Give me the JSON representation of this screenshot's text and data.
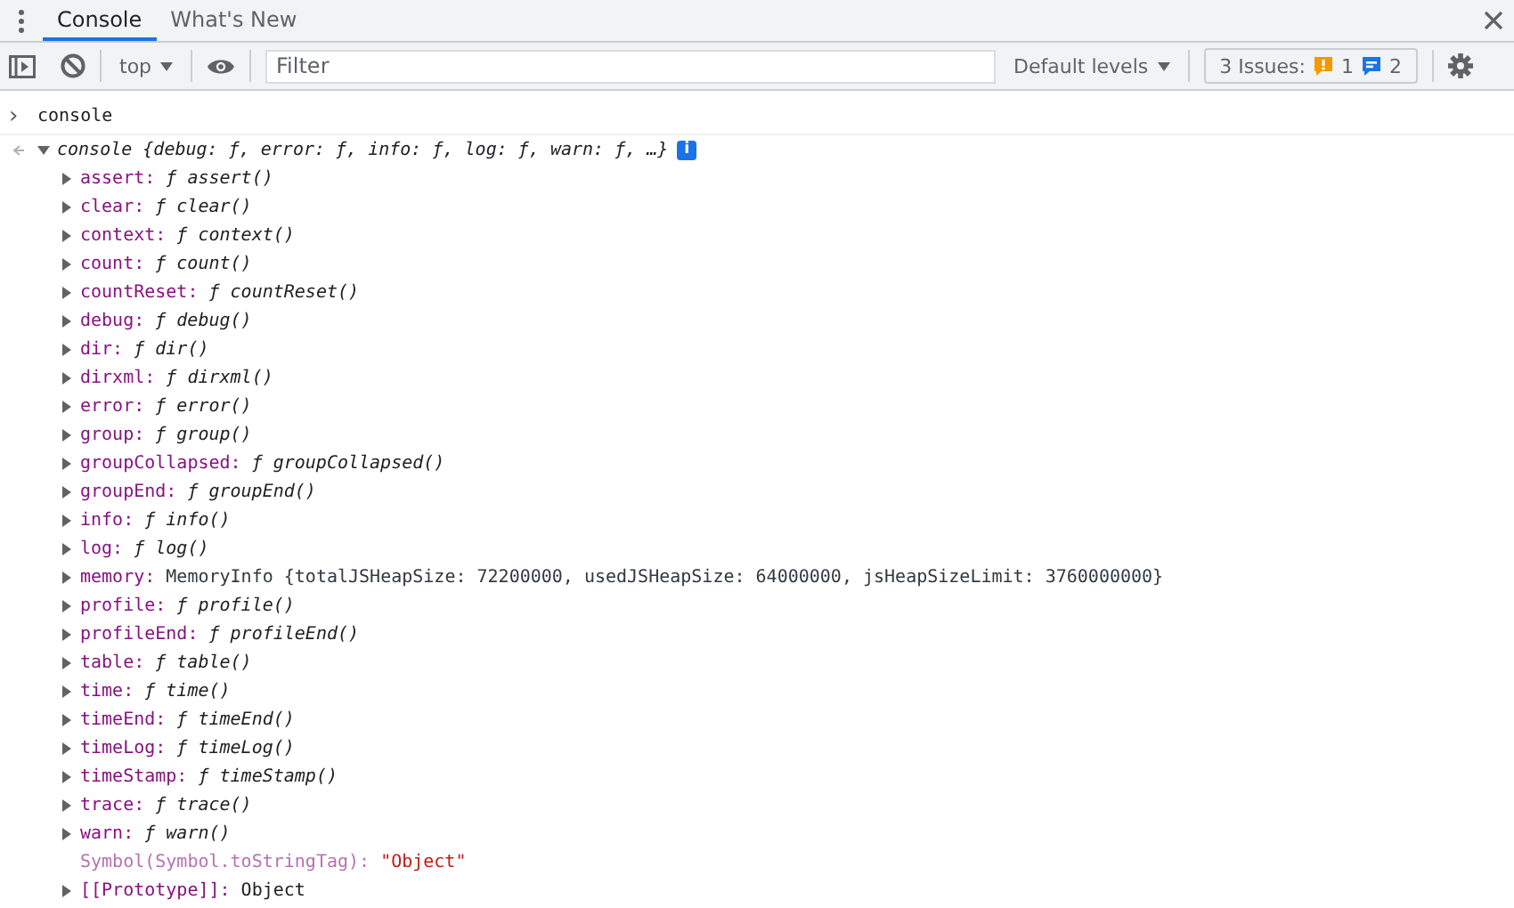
{
  "tabs": [
    {
      "label": "Console",
      "selected": true
    },
    {
      "label": "What's New",
      "selected": false
    }
  ],
  "toolbar": {
    "context": "top",
    "filter": {
      "placeholder": "Filter"
    },
    "levels": "Default levels",
    "issues": {
      "label": "3 Issues:",
      "warnings": "1",
      "infos": "2"
    }
  },
  "input": {
    "prompt": "›",
    "text": "console"
  },
  "output": {
    "expanded": true,
    "summary": "console {debug: ƒ, error: ƒ, info: ƒ, log: ƒ, warn: ƒ, …}",
    "badge": "i",
    "properties": [
      {
        "kind": "function",
        "key": "assert:",
        "value": "ƒ assert()",
        "expanded": false
      },
      {
        "kind": "function",
        "key": "clear:",
        "value": "ƒ clear()",
        "expanded": false
      },
      {
        "kind": "function",
        "key": "context:",
        "value": "ƒ context()",
        "expanded": false
      },
      {
        "kind": "function",
        "key": "count:",
        "value": "ƒ count()",
        "expanded": false
      },
      {
        "kind": "function",
        "key": "countReset:",
        "value": "ƒ countReset()",
        "expanded": false
      },
      {
        "kind": "function",
        "key": "debug:",
        "value": "ƒ debug()",
        "expanded": false
      },
      {
        "kind": "function",
        "key": "dir:",
        "value": "ƒ dir()",
        "expanded": false
      },
      {
        "kind": "function",
        "key": "dirxml:",
        "value": "ƒ dirxml()",
        "expanded": false
      },
      {
        "kind": "function",
        "key": "error:",
        "value": "ƒ error()",
        "expanded": false
      },
      {
        "kind": "function",
        "key": "group:",
        "value": "ƒ group()",
        "expanded": false
      },
      {
        "kind": "function",
        "key": "groupCollapsed:",
        "value": "ƒ groupCollapsed()",
        "expanded": false
      },
      {
        "kind": "function",
        "key": "groupEnd:",
        "value": "ƒ groupEnd()",
        "expanded": false
      },
      {
        "kind": "function",
        "key": "info:",
        "value": "ƒ info()",
        "expanded": false
      },
      {
        "kind": "function",
        "key": "log:",
        "value": "ƒ log()",
        "expanded": false
      },
      {
        "kind": "object",
        "key": "memory:",
        "value": "MemoryInfo {totalJSHeapSize: 72200000, usedJSHeapSize: 64000000, jsHeapSizeLimit: 3760000000}",
        "expanded": false
      },
      {
        "kind": "function",
        "key": "profile:",
        "value": "ƒ profile()",
        "expanded": false
      },
      {
        "kind": "function",
        "key": "profileEnd:",
        "value": "ƒ profileEnd()",
        "expanded": false
      },
      {
        "kind": "function",
        "key": "table:",
        "value": "ƒ table()",
        "expanded": false
      },
      {
        "kind": "function",
        "key": "time:",
        "value": "ƒ time()",
        "expanded": false
      },
      {
        "kind": "function",
        "key": "timeEnd:",
        "value": "ƒ timeEnd()",
        "expanded": false
      },
      {
        "kind": "function",
        "key": "timeLog:",
        "value": "ƒ timeLog()",
        "expanded": false
      },
      {
        "kind": "function",
        "key": "timeStamp:",
        "value": "ƒ timeStamp()",
        "expanded": false
      },
      {
        "kind": "function",
        "key": "trace:",
        "value": "ƒ trace()",
        "expanded": false
      },
      {
        "kind": "function",
        "key": "warn:",
        "value": "ƒ warn()",
        "expanded": false
      },
      {
        "kind": "symbol",
        "key": "Symbol(Symbol.toStringTag):",
        "value": "\"Object\""
      },
      {
        "kind": "prototype",
        "key": "[[Prototype]]:",
        "value": "Object",
        "expanded": false
      }
    ]
  }
}
